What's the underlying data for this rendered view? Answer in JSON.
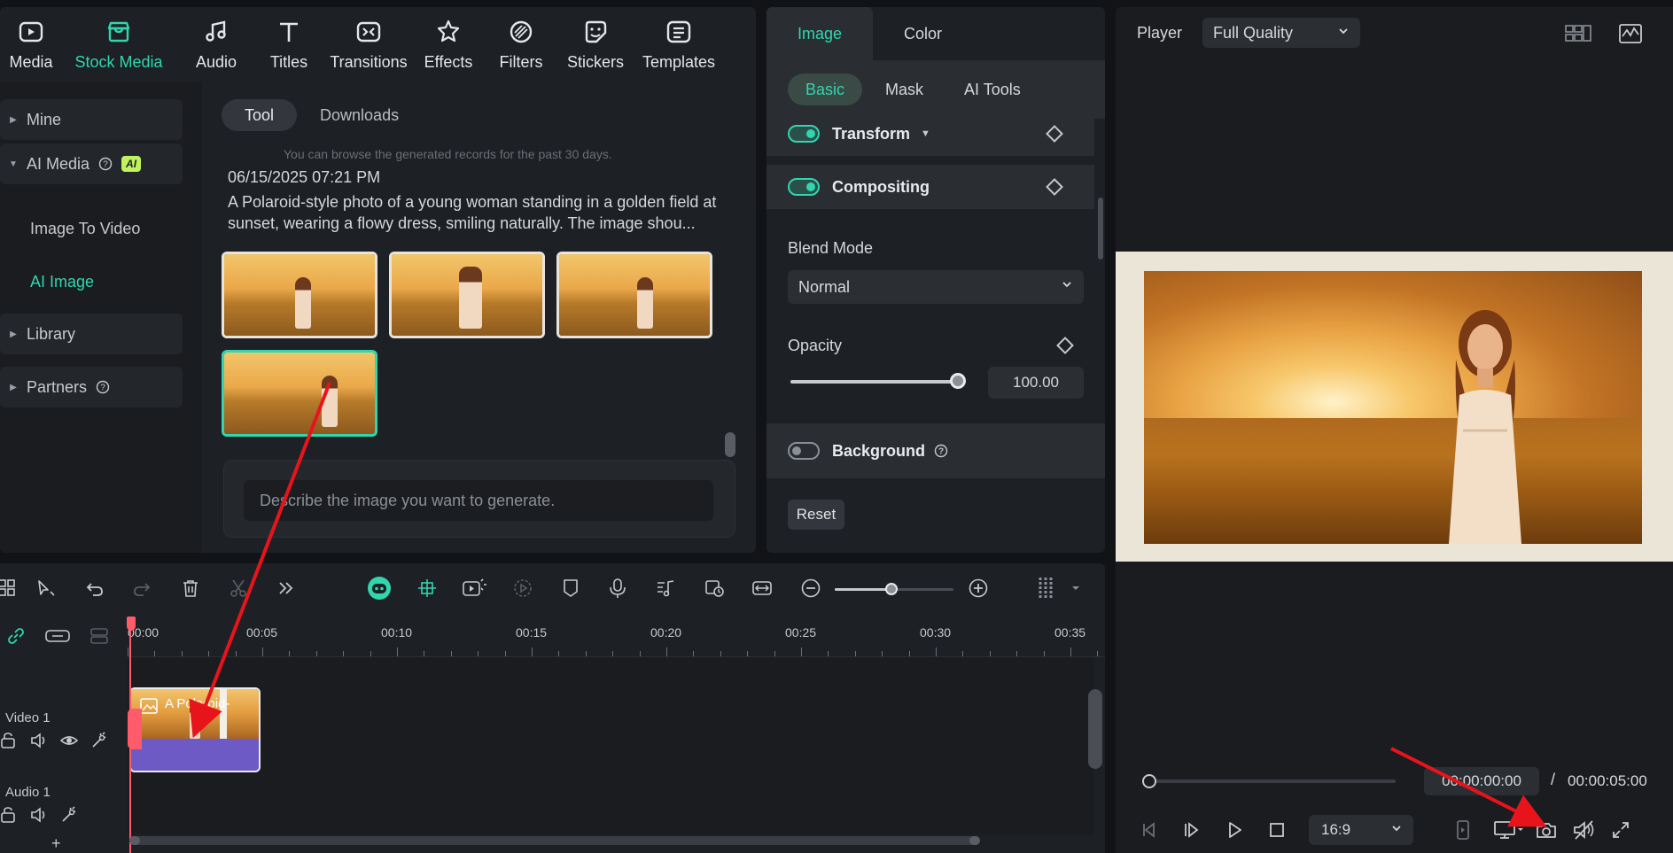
{
  "media": {
    "tabs": [
      {
        "label": "Media",
        "icon": "media-icon"
      },
      {
        "label": "Stock Media",
        "icon": "stock-media-icon",
        "active": true
      },
      {
        "label": "Audio",
        "icon": "audio-icon"
      },
      {
        "label": "Titles",
        "icon": "titles-icon"
      },
      {
        "label": "Transitions",
        "icon": "transitions-icon"
      },
      {
        "label": "Effects",
        "icon": "effects-icon"
      },
      {
        "label": "Filters",
        "icon": "filters-icon"
      },
      {
        "label": "Stickers",
        "icon": "stickers-icon"
      },
      {
        "label": "Templates",
        "icon": "templates-icon"
      }
    ],
    "sidebar": {
      "mine": "Mine",
      "ai_media": "AI Media",
      "ai_badge": "AI",
      "image_to_video": "Image To Video",
      "ai_image": "AI Image",
      "library": "Library",
      "partners": "Partners"
    },
    "subtabs": {
      "tool": "Tool",
      "downloads": "Downloads"
    },
    "hint": "You can browse the generated records for the past 30 days.",
    "record": {
      "timestamp": "06/15/2025 07:21 PM",
      "prompt": "A Polaroid-style photo of a young woman standing in a golden field at sunset, wearing a flowy dress, smiling naturally. The image shou..."
    },
    "generate_placeholder": "Describe the image you want to generate."
  },
  "properties": {
    "tabs": {
      "image": "Image",
      "color": "Color"
    },
    "subtabs": {
      "basic": "Basic",
      "mask": "Mask",
      "ai_tools": "AI Tools"
    },
    "transform": "Transform",
    "compositing": "Compositing",
    "blend_mode_label": "Blend Mode",
    "blend_mode_value": "Normal",
    "opacity_label": "Opacity",
    "opacity_value": "100.00",
    "background": "Background",
    "reset": "Reset"
  },
  "player": {
    "label": "Player",
    "quality": "Full Quality",
    "current_time": "00:00:00:00",
    "separator": "/",
    "total_time": "00:00:05:00",
    "ratio": "16:9"
  },
  "timeline": {
    "ticks": [
      "00:00",
      "00:05",
      "00:10",
      "00:15",
      "00:20",
      "00:25",
      "00:30",
      "00:35"
    ],
    "video_track": "Video 1",
    "audio_track": "Audio 1",
    "clip_label": "A Polaroid-",
    "add_track": "+"
  },
  "colors": {
    "accent": "#31d6ae",
    "playhead": "#ff5b6a",
    "clip": "#6d5ac4",
    "annotation": "#e8141c"
  }
}
